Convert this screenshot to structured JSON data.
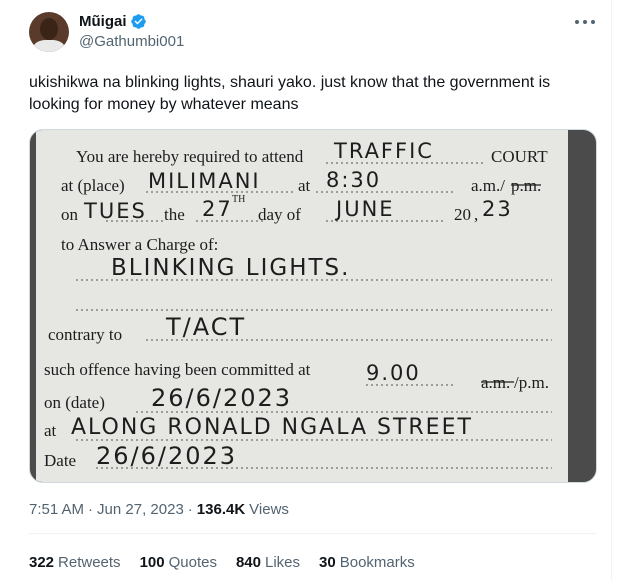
{
  "author": {
    "name": "Mũigai",
    "handle": "@Gathumbi001",
    "verified_icon": "verified-badge-icon",
    "accent": "#1d9bf0"
  },
  "tweet": {
    "text": "ukishikwa na blinking lights, shauri yako. just know that the government is looking for money by whatever means"
  },
  "form": {
    "line1_print": "You are hereby required to attend",
    "line1_hand": "TRAFFIC",
    "line1_tail": "COURT",
    "line2_print": "at (place)",
    "line2_hand": "MILIMANI",
    "line2_at": "at",
    "line2_time": "8:30",
    "line2_tail": "a.m./",
    "line2_strike": "p.m.",
    "line3_on": "on",
    "line3_day": "TUES",
    "line3_the": "the",
    "line3_date": "27",
    "line3_sup": "TH",
    "line3_dayof": "day of",
    "line3_month": "JUNE",
    "line3_year_print": "20",
    "line3_year_hand": "23",
    "line4_print": "to Answer a Charge of:",
    "line5_hand": "BLINKING LIGHTS.",
    "line6_print": "contrary to",
    "line6_hand": "T/ACT",
    "line7_print": "such offence having been committed at",
    "line7_hand": "9.00",
    "line7_strike": "a.m.",
    "line7_tail": "/p.m.",
    "line8_print": "on (date)",
    "line8_hand": "26/6/2023",
    "line9_print": "at",
    "line9_hand": "ALONG RONALD NGALA STREET",
    "line10_print": "Date",
    "line10_hand": "26/6/2023"
  },
  "meta": {
    "time": "7:51 AM",
    "sep1": "·",
    "date": "Jun 27, 2023",
    "sep2": "·",
    "views_count": "136.4K",
    "views_label": "Views"
  },
  "stats": {
    "retweets_count": "322",
    "retweets_label": "Retweets",
    "quotes_count": "100",
    "quotes_label": "Quotes",
    "likes_count": "840",
    "likes_label": "Likes",
    "bookmarks_count": "30",
    "bookmarks_label": "Bookmarks"
  }
}
